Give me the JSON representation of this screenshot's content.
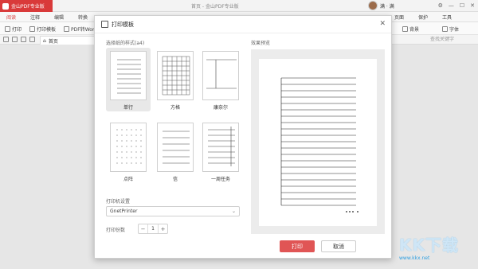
{
  "app": {
    "badge": "金山PDF专业版",
    "doc_title": "首页 - 金山PDF专业版",
    "user_name": "满 · 满",
    "colors": {
      "accent": "#d93a3a",
      "primary_button": "#e05555"
    }
  },
  "menu": {
    "tabs": [
      "阅读",
      "注释",
      "编辑",
      "转换",
      "页面",
      "保护",
      "工具"
    ]
  },
  "toolbar": {
    "items": [
      "打印",
      "打印模板",
      "PDF转Word"
    ],
    "right": [
      "背景",
      "字体"
    ],
    "search_placeholder": "查找关键字"
  },
  "tabs": {
    "home": "首页"
  },
  "dialog": {
    "title": "打印模板",
    "section_template_label": "选择纸的样式(a4)",
    "preview_label": "效果预览",
    "templates": [
      {
        "label": "单行",
        "selected": true,
        "icon": "lined-paper-icon"
      },
      {
        "label": "方格",
        "selected": false,
        "icon": "grid-paper-icon"
      },
      {
        "label": "康奈尔",
        "selected": false,
        "icon": "cornell-paper-icon"
      },
      {
        "label": "点阵",
        "selected": false,
        "icon": "dot-paper-icon"
      },
      {
        "label": "信",
        "selected": false,
        "icon": "letter-paper-icon"
      },
      {
        "label": "一周任务",
        "selected": false,
        "icon": "weekly-task-icon"
      }
    ],
    "printer_setting_label": "打印机设置",
    "printer_value": "GnetPrinter",
    "copies_label": "打印份数",
    "copies_value": "1",
    "print_button": "打印",
    "cancel_button": "取消"
  },
  "watermark": {
    "text": "KK下载",
    "url": "www.kkx.net"
  }
}
